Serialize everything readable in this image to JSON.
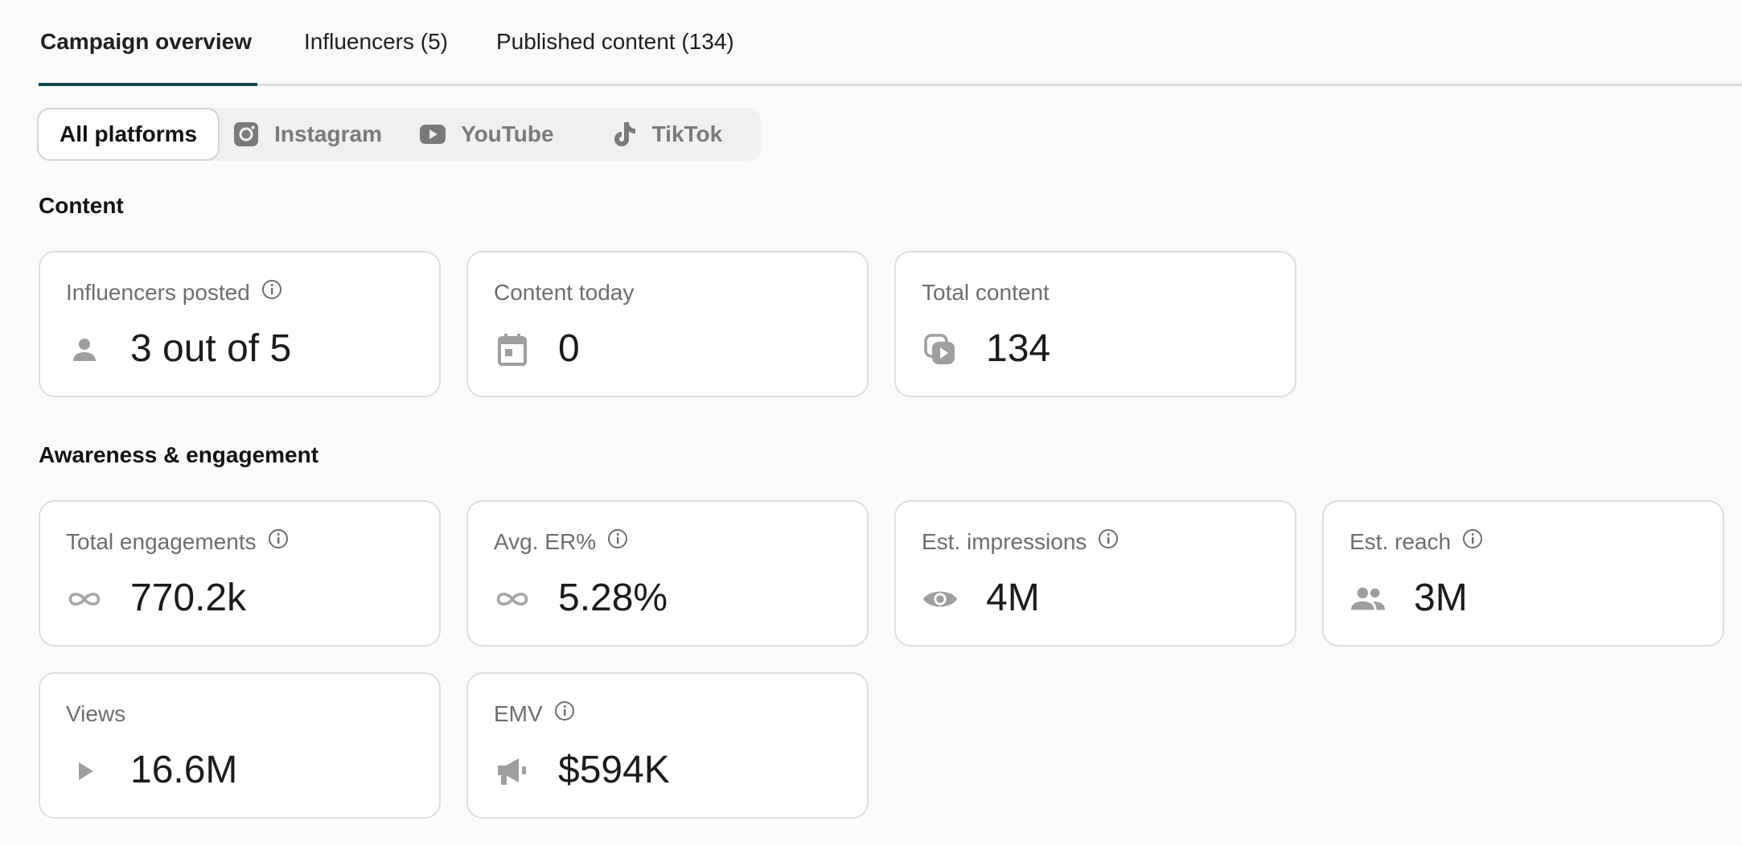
{
  "tabs": [
    {
      "label": "Campaign overview"
    },
    {
      "label": "Influencers (5)"
    },
    {
      "label": "Published content (134)"
    }
  ],
  "platforms": {
    "all": "All platforms",
    "instagram": "Instagram",
    "youtube": "YouTube",
    "tiktok": "TikTok"
  },
  "sections": {
    "content": "Content",
    "awareness": "Awareness & engagement"
  },
  "content_cards": {
    "influencers_posted": {
      "label": "Influencers posted",
      "value": "3 out of 5",
      "icon": "person-icon"
    },
    "content_today": {
      "label": "Content today",
      "value": "0",
      "icon": "calendar-icon"
    },
    "total_content": {
      "label": "Total content",
      "value": "134",
      "icon": "media-stack-icon"
    }
  },
  "awareness_cards": {
    "total_engagements": {
      "label": "Total engagements",
      "value": "770.2k",
      "icon": "infinity-icon"
    },
    "avg_er": {
      "label": "Avg. ER%",
      "value": "5.28%",
      "icon": "infinity-icon"
    },
    "est_impressions": {
      "label": "Est. impressions",
      "value": "4M",
      "icon": "eye-icon"
    },
    "est_reach": {
      "label": "Est. reach",
      "value": "3M",
      "icon": "people-icon"
    },
    "views": {
      "label": "Views",
      "value": "16.6M",
      "icon": "play-icon"
    },
    "emv": {
      "label": "EMV",
      "value": "$594K",
      "icon": "megaphone-icon"
    }
  },
  "colors": {
    "active_tab_underline": "#13474f",
    "icon_gray": "#9e9e9e",
    "card_border": "#dedede"
  }
}
